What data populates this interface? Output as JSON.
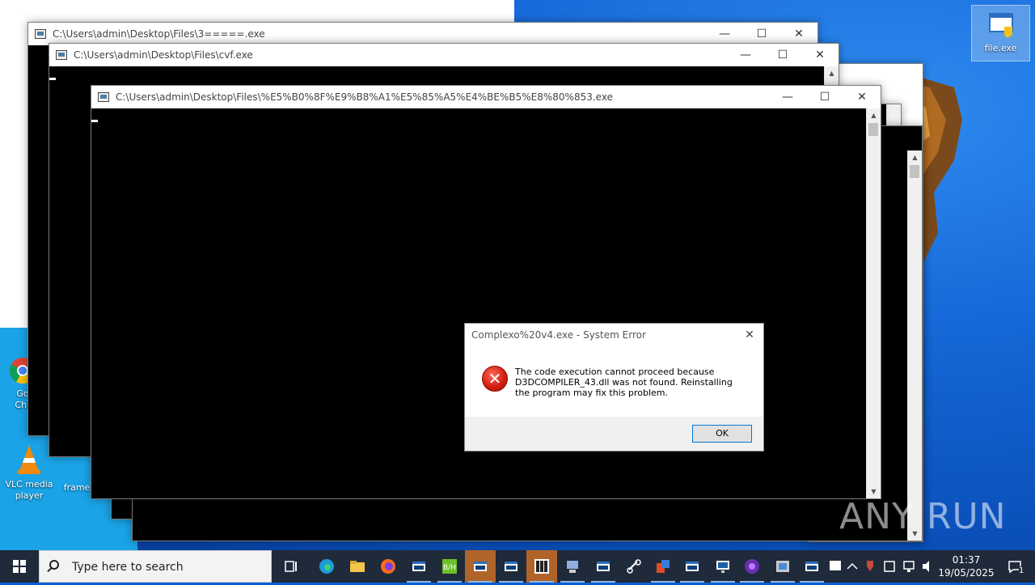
{
  "desktop": {
    "icons": [
      {
        "label": "file.exe"
      },
      {
        "label": "Go\nChr"
      },
      {
        "label": "VLC media player"
      },
      {
        "label": "frame"
      }
    ]
  },
  "windows": [
    {
      "title": "C:\\Users\\admin\\Desktop\\Files\\3=====.exe"
    },
    {
      "title": "C:\\Users\\admin\\Desktop\\Files\\cvf.exe"
    },
    {
      "title": "C:\\Users\\admin\\Desktop\\Files\\%E5%B0%8F%E9%B8%A1%E5%85%A5%E4%BE%B5%E8%80%853.exe"
    }
  ],
  "window_controls": {
    "minimize": "—",
    "maximize": "☐",
    "close": "✕"
  },
  "dialog": {
    "title": "Complexo%20v4.exe - System Error",
    "message": "The code execution cannot proceed because D3DCOMPILER_43.dll was not found. Reinstalling the program may fix this problem.",
    "ok_label": "OK",
    "close_glyph": "✕"
  },
  "taskbar": {
    "search_placeholder": "Type here to search",
    "clock_time": "01:37",
    "clock_date": "19/05/2025",
    "notification_count": "1",
    "pinned": [
      "task-view",
      "edge",
      "file-explorer",
      "firefox",
      "console-1",
      "bh-app",
      "console-2",
      "console-3",
      "app-grid",
      "network-tool",
      "console-4",
      "link-tool",
      "office-app",
      "console-5",
      "monitor-app",
      "media-app",
      "install-app",
      "console-6"
    ]
  },
  "watermark": "ANY RUN"
}
